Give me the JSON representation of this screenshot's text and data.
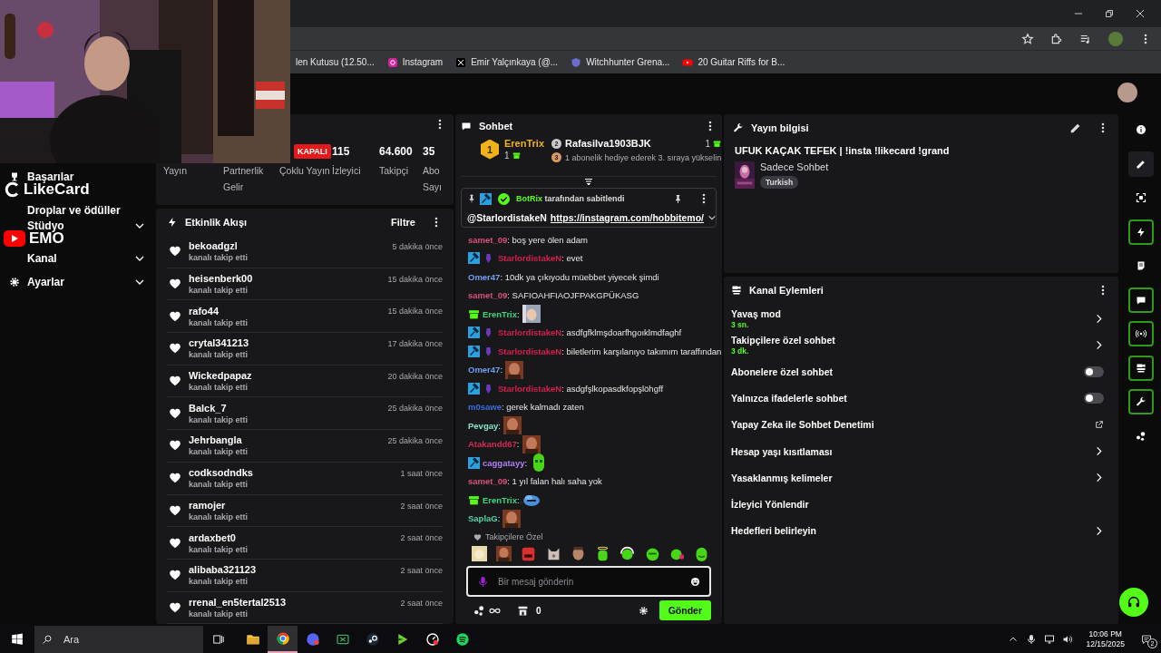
{
  "browser": {
    "bookmarks": [
      {
        "label": "len Kutusu (12.50...",
        "kind": "none"
      },
      {
        "label": "Instagram",
        "kind": "instagram"
      },
      {
        "label": "Emir Yalçınkaya (@...",
        "kind": "x"
      },
      {
        "label": "Witchhunter Grena...",
        "kind": "shield"
      },
      {
        "label": "20 Guitar Riffs for B...",
        "kind": "youtube"
      }
    ]
  },
  "overlay": {
    "logo_text": "LikeCard",
    "channel_text": "EMO"
  },
  "sidebar": {
    "items": [
      {
        "label": "Başarılar"
      },
      {
        "label": "Droplar ve ödüller"
      },
      {
        "label": "Stüdyo",
        "expanded": false
      },
      {
        "label": "Kanal",
        "expanded": false
      },
      {
        "label": "Ayarlar",
        "expanded": false
      }
    ]
  },
  "stats": {
    "items": [
      {
        "label": "Yayın",
        "kind": "hidden"
      },
      {
        "label": "Partnerlik Gelir",
        "kind": "hidden"
      },
      {
        "label": "Çoklu Yayın",
        "value": "KAPALI",
        "kind": "badge"
      },
      {
        "label": "İzleyici",
        "value": "115",
        "kind": "number"
      },
      {
        "label": "Takipçi",
        "value": "64.600",
        "kind": "number"
      },
      {
        "label": "Abo Sayı",
        "value": "35",
        "kind": "number"
      }
    ]
  },
  "activity": {
    "title": "Etkinlik Akışı",
    "filter": "Filtre",
    "events": [
      {
        "user": "bekoadgzl",
        "action": "kanalı takip etti",
        "time": "5 dakika önce"
      },
      {
        "user": "heisenberk00",
        "action": "kanalı takip etti",
        "time": "15 dakika önce"
      },
      {
        "user": "rafo44",
        "action": "kanalı takip etti",
        "time": "15 dakika önce"
      },
      {
        "user": "crytal341213",
        "action": "kanalı takip etti",
        "time": "17 dakika önce"
      },
      {
        "user": "Wickedpapaz",
        "action": "kanalı takip etti",
        "time": "20 dakika önce"
      },
      {
        "user": "Balck_7",
        "action": "kanalı takip etti",
        "time": "25 dakika önce"
      },
      {
        "user": "Jehrbangla",
        "action": "kanalı takip etti",
        "time": "25 dakika önce"
      },
      {
        "user": "codksodndks",
        "action": "kanalı takip etti",
        "time": "1 saat önce"
      },
      {
        "user": "ramojer",
        "action": "kanalı takip etti",
        "time": "2 saat önce"
      },
      {
        "user": "ardaxbet0",
        "action": "kanalı takip etti",
        "time": "2 saat önce"
      },
      {
        "user": "alibaba321123",
        "action": "kanalı takip etti",
        "time": "2 saat önce"
      },
      {
        "user": "rrenal_en5tertal2513",
        "action": "kanalı takip etti",
        "time": "2 saat önce"
      }
    ]
  },
  "chat": {
    "title": "Sohbet",
    "leaders": [
      {
        "rank": "1",
        "user": "ErenTrix",
        "count": "1"
      },
      {
        "rank": "2",
        "user": "Rafasilva1903BJK",
        "count": "1"
      },
      {
        "rank": "3",
        "text": "1 abonelik hediye ederek 3. sıraya yükselin"
      }
    ],
    "pinned": {
      "by": "BotRix",
      "note": "tarafından sabitlendi",
      "mention": "@StarlordistakeN",
      "link": "https://instagram.com/hobbitemo/"
    },
    "messages": [
      {
        "user": "samet_09",
        "color": "#d9507a",
        "moderator": false,
        "og": false,
        "subscriber": false,
        "kind": "text",
        "text": ": boş yere ölen adam"
      },
      {
        "user": "StarlordistakeN",
        "color": "#d41f4f",
        "moderator": true,
        "og": true,
        "subscriber": false,
        "kind": "text",
        "text": ": evet"
      },
      {
        "user": "Omer47",
        "color": "#6f9ff0",
        "moderator": false,
        "og": false,
        "subscriber": false,
        "kind": "text",
        "text": ": 10dk ya çıkıyodu müebbet yiyecek şimdi"
      },
      {
        "user": "samet_09",
        "color": "#d9507a",
        "moderator": false,
        "og": false,
        "subscriber": false,
        "kind": "text",
        "text": ": SAFIOAHFIAOJFPAKGPÜKASG"
      },
      {
        "user": "ErenTrix",
        "color": "#3ad67f",
        "moderator": false,
        "og": false,
        "subscriber": true,
        "text": ":"
      },
      {
        "user": "StarlordistakeN",
        "color": "#d41f4f",
        "moderator": true,
        "og": true,
        "subscriber": false,
        "kind": "text",
        "text": ": asdfgfklmşdoarfhgoıklmdfaghf"
      },
      {
        "user": "StarlordistakeN",
        "color": "#d41f4f",
        "moderator": true,
        "og": true,
        "subscriber": false,
        "kind": "text",
        "text": ": biletlerim karşılanıyo takımım taraffından"
      },
      {
        "user": "Omer47",
        "color": "#6f9ff0",
        "moderator": false,
        "og": false,
        "subscriber": false,
        "kind": "face",
        "text": ":"
      },
      {
        "user": "StarlordistakeN",
        "color": "#d41f4f",
        "moderator": true,
        "og": true,
        "subscriber": false,
        "kind": "text",
        "text": ": asdgfşlkopasdkfopşlöhgff"
      },
      {
        "user": "m0sawe",
        "color": "#3a6ee0",
        "moderator": false,
        "og": false,
        "subscriber": false,
        "kind": "text",
        "text": ": gerek kalmadı zaten"
      },
      {
        "user": "Pevgay",
        "color": "#86e3c8",
        "moderator": false,
        "og": false,
        "subscriber": false,
        "kind": "face",
        "text": ":"
      },
      {
        "user": "Atakandd67",
        "color": "#d42a52",
        "moderator": false,
        "og": false,
        "subscriber": false,
        "kind": "face",
        "text": ":"
      },
      {
        "user": "caggatayy",
        "color": "#b27ff2",
        "moderator": true,
        "og": false,
        "subscriber": false,
        "kind": "blob",
        "text": ":"
      },
      {
        "user": "samet_09",
        "color": "#d9507a",
        "moderator": false,
        "og": false,
        "subscriber": false,
        "kind": "text",
        "text": ": 1 yıl falan halı saha yok"
      },
      {
        "user": "ErenTrix",
        "color": "#3ad67f",
        "moderator": false,
        "og": false,
        "subscriber": true,
        "kind": "cloud",
        "text": ":"
      },
      {
        "user": "SaplaG",
        "color": "#4fd3a6",
        "moderator": false,
        "og": false,
        "subscriber": false,
        "kind": "face",
        "text": ":"
      }
    ],
    "emote_label": "Takipçilere Özel",
    "input_placeholder": "Bir mesaj gönderin",
    "points": "0",
    "send": "Gönder"
  },
  "stream_info": {
    "title": "Yayın bilgisi",
    "stream_title": "UFUK KAÇAK TEFEK | !insta !likecard !grand",
    "category": "Sadece Sohbet",
    "tags": [
      "Turkish"
    ]
  },
  "channel_actions": {
    "title": "Kanal Eylemleri",
    "items": [
      {
        "label": "Yavaş mod",
        "sub": "3 sn.",
        "kind": "arrow"
      },
      {
        "label": "Takipçilere özel sohbet",
        "sub": "3 dk.",
        "kind": "arrow"
      },
      {
        "label": "Abonelere özel sohbet",
        "kind": "toggle",
        "on": false
      },
      {
        "label": "Yalnızca ifadelerle sohbet",
        "kind": "toggle",
        "on": false
      },
      {
        "label": "Yapay Zeka ile Sohbet Denetimi",
        "kind": "external"
      },
      {
        "label": "Hesap yaşı kısıtlaması",
        "kind": "arrow"
      },
      {
        "label": "Yasaklanmış kelimeler",
        "kind": "arrow"
      },
      {
        "label": "İzleyici Yönlendir",
        "kind": "plain"
      },
      {
        "label": "Hedefleri belirleyin",
        "kind": "arrow"
      }
    ]
  },
  "rail": [
    {
      "kind": "info",
      "on": false
    },
    {
      "kind": "pencil",
      "on": false
    },
    {
      "kind": "focus",
      "on": false
    },
    {
      "kind": "bolt",
      "on": true
    },
    {
      "kind": "notes",
      "on": false
    },
    {
      "kind": "chat",
      "on": true
    },
    {
      "kind": "broadcast",
      "on": true
    },
    {
      "kind": "channel",
      "on": true
    },
    {
      "kind": "wrench",
      "on": true
    },
    {
      "kind": "bubbles",
      "on": false
    }
  ],
  "taskbar": {
    "search_placeholder": "Ara",
    "apps": [
      {
        "kind": "explorer",
        "selected": false
      },
      {
        "kind": "chrome",
        "selected": true
      },
      {
        "kind": "discord",
        "selected": false
      },
      {
        "kind": "xbox",
        "selected": false
      },
      {
        "kind": "steam",
        "selected": false
      },
      {
        "kind": "play",
        "selected": false
      },
      {
        "kind": "gauge",
        "selected": false
      },
      {
        "kind": "spotify",
        "selected": false
      }
    ],
    "time": "10:06 PM",
    "date": "12/15/2025",
    "notifications": "2"
  }
}
